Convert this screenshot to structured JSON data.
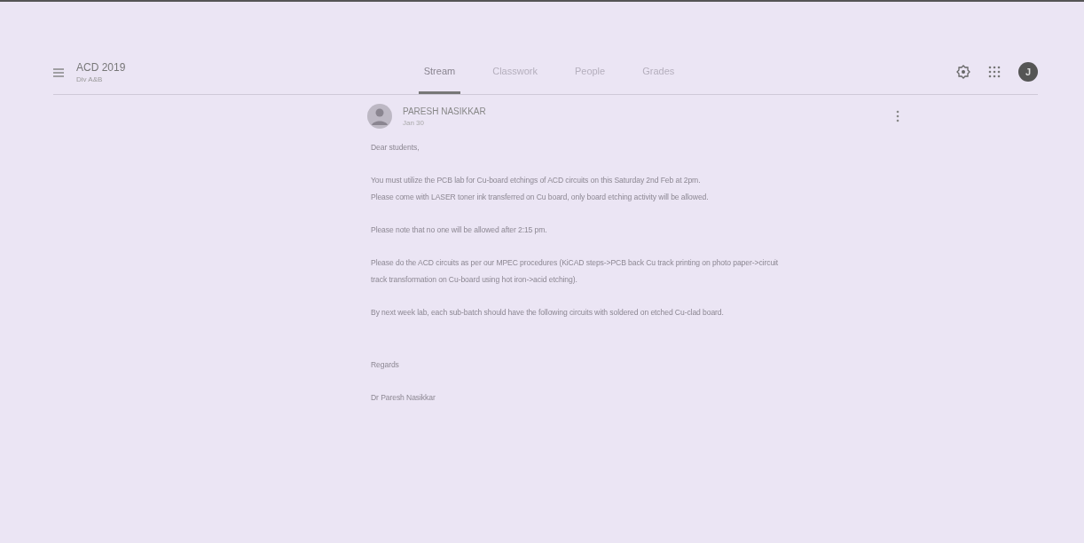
{
  "course": {
    "title": "ACD 2019",
    "subtitle": "Div A&B"
  },
  "tabs": [
    {
      "label": "Stream",
      "selected": true
    },
    {
      "label": "Classwork",
      "selected": false
    },
    {
      "label": "People",
      "selected": false
    },
    {
      "label": "Grades",
      "selected": false
    }
  ],
  "account": {
    "initial": "J"
  },
  "post": {
    "author": "PARESH NASIKKAR",
    "date": "Jan 30",
    "paragraphs": [
      [
        "Dear students,"
      ],
      [
        "You must utilize the PCB lab for Cu-board etchings of ACD circuits on this Saturday 2nd Feb at 2pm.",
        "Please come with LASER toner ink transferred on Cu board, only board etching activity will be allowed."
      ],
      [
        "Please note that no one will be allowed after 2:15 pm."
      ],
      [
        "Please do the ACD circuits as per our MPEC procedures (KiCAD steps->PCB back Cu track printing on photo paper->circuit",
        "track transformation on Cu-board using hot iron->acid etching)."
      ],
      [
        "By next week lab, each sub-batch should have the following circuits with soldered on etched Cu-clad board."
      ],
      [
        "Regards"
      ],
      [
        "Dr Paresh Nasikkar"
      ]
    ]
  }
}
